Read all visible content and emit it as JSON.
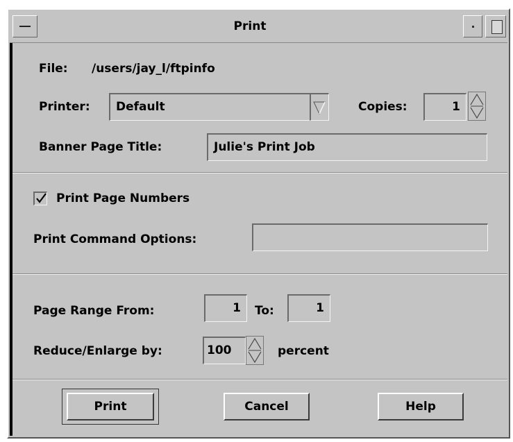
{
  "window": {
    "title": "Print"
  },
  "file": {
    "label": "File:",
    "path": "/users/jay_l/ftpinfo"
  },
  "printer": {
    "label": "Printer:",
    "value": "Default"
  },
  "copies": {
    "label": "Copies:",
    "value": "1"
  },
  "banner": {
    "label": "Banner Page Title:",
    "value": "Julie's Print Job"
  },
  "page_numbers": {
    "label": "Print Page Numbers",
    "checked": true
  },
  "command_options": {
    "label": "Print Command Options:",
    "value": ""
  },
  "page_range": {
    "from_label": "Page Range From:",
    "from_value": "1",
    "to_label": "To:",
    "to_value": "1"
  },
  "scale": {
    "label": "Reduce/Enlarge by:",
    "value": "100",
    "unit": "percent"
  },
  "buttons": {
    "print": "Print",
    "cancel": "Cancel",
    "help": "Help"
  },
  "colors": {
    "background": "#c4c4c4",
    "text": "#000000"
  },
  "icons": [
    "window-menu-icon",
    "minimize-icon",
    "maximize-icon",
    "dropdown-arrow-icon",
    "spinner-arrows-icon",
    "checkmark-icon"
  ]
}
